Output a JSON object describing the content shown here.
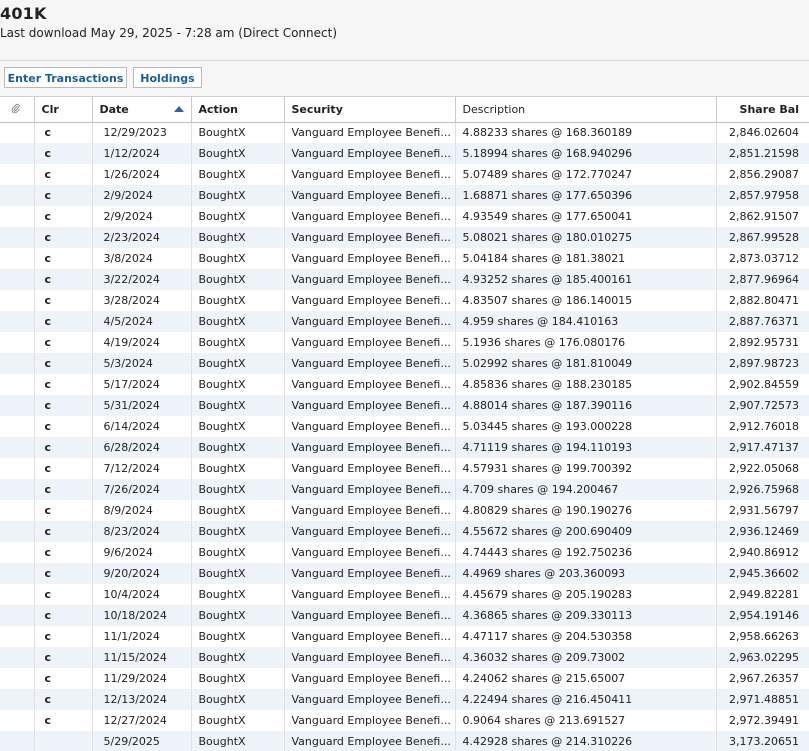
{
  "account": {
    "title": "401K",
    "last_download": "Last download May 29, 2025 - 7:28 am (Direct Connect)"
  },
  "tabs": {
    "enter_transactions": "Enter Transactions",
    "holdings": "Holdings"
  },
  "table": {
    "columns": {
      "attach_icon": "paperclip-icon",
      "clr": "Clr",
      "date": "Date",
      "action": "Action",
      "security": "Security",
      "description": "Description",
      "share_bal": "Share Bal"
    },
    "sort": {
      "column": "date",
      "direction": "ascending"
    },
    "rows": [
      {
        "clr": "c",
        "date": "12/29/2023",
        "action": "BoughtX",
        "security": "Vanguard Employee Benefi...",
        "description": "4.88233 shares @ 168.360189",
        "share_bal": "2,846.02604"
      },
      {
        "clr": "c",
        "date": "1/12/2024",
        "action": "BoughtX",
        "security": "Vanguard Employee Benefi...",
        "description": "5.18994 shares @ 168.940296",
        "share_bal": "2,851.21598"
      },
      {
        "clr": "c",
        "date": "1/26/2024",
        "action": "BoughtX",
        "security": "Vanguard Employee Benefi...",
        "description": "5.07489 shares @ 172.770247",
        "share_bal": "2,856.29087"
      },
      {
        "clr": "c",
        "date": "2/9/2024",
        "action": "BoughtX",
        "security": "Vanguard Employee Benefi...",
        "description": "1.68871 shares @ 177.650396",
        "share_bal": "2,857.97958"
      },
      {
        "clr": "c",
        "date": "2/9/2024",
        "action": "BoughtX",
        "security": "Vanguard Employee Benefi...",
        "description": "4.93549 shares @ 177.650041",
        "share_bal": "2,862.91507"
      },
      {
        "clr": "c",
        "date": "2/23/2024",
        "action": "BoughtX",
        "security": "Vanguard Employee Benefi...",
        "description": "5.08021 shares @ 180.010275",
        "share_bal": "2,867.99528"
      },
      {
        "clr": "c",
        "date": "3/8/2024",
        "action": "BoughtX",
        "security": "Vanguard Employee Benefi...",
        "description": "5.04184 shares @ 181.38021",
        "share_bal": "2,873.03712"
      },
      {
        "clr": "c",
        "date": "3/22/2024",
        "action": "BoughtX",
        "security": "Vanguard Employee Benefi...",
        "description": "4.93252 shares @ 185.400161",
        "share_bal": "2,877.96964"
      },
      {
        "clr": "c",
        "date": "3/28/2024",
        "action": "BoughtX",
        "security": "Vanguard Employee Benefi...",
        "description": "4.83507 shares @ 186.140015",
        "share_bal": "2,882.80471"
      },
      {
        "clr": "c",
        "date": "4/5/2024",
        "action": "BoughtX",
        "security": "Vanguard Employee Benefi...",
        "description": "4.959 shares @ 184.410163",
        "share_bal": "2,887.76371"
      },
      {
        "clr": "c",
        "date": "4/19/2024",
        "action": "BoughtX",
        "security": "Vanguard Employee Benefi...",
        "description": "5.1936 shares @ 176.080176",
        "share_bal": "2,892.95731"
      },
      {
        "clr": "c",
        "date": "5/3/2024",
        "action": "BoughtX",
        "security": "Vanguard Employee Benefi...",
        "description": "5.02992 shares @ 181.810049",
        "share_bal": "2,897.98723"
      },
      {
        "clr": "c",
        "date": "5/17/2024",
        "action": "BoughtX",
        "security": "Vanguard Employee Benefi...",
        "description": "4.85836 shares @ 188.230185",
        "share_bal": "2,902.84559"
      },
      {
        "clr": "c",
        "date": "5/31/2024",
        "action": "BoughtX",
        "security": "Vanguard Employee Benefi...",
        "description": "4.88014 shares @ 187.390116",
        "share_bal": "2,907.72573"
      },
      {
        "clr": "c",
        "date": "6/14/2024",
        "action": "BoughtX",
        "security": "Vanguard Employee Benefi...",
        "description": "5.03445 shares @ 193.000228",
        "share_bal": "2,912.76018"
      },
      {
        "clr": "c",
        "date": "6/28/2024",
        "action": "BoughtX",
        "security": "Vanguard Employee Benefi...",
        "description": "4.71119 shares @ 194.110193",
        "share_bal": "2,917.47137"
      },
      {
        "clr": "c",
        "date": "7/12/2024",
        "action": "BoughtX",
        "security": "Vanguard Employee Benefi...",
        "description": "4.57931 shares @ 199.700392",
        "share_bal": "2,922.05068"
      },
      {
        "clr": "c",
        "date": "7/26/2024",
        "action": "BoughtX",
        "security": "Vanguard Employee Benefi...",
        "description": "4.709 shares @ 194.200467",
        "share_bal": "2,926.75968"
      },
      {
        "clr": "c",
        "date": "8/9/2024",
        "action": "BoughtX",
        "security": "Vanguard Employee Benefi...",
        "description": "4.80829 shares @ 190.190276",
        "share_bal": "2,931.56797"
      },
      {
        "clr": "c",
        "date": "8/23/2024",
        "action": "BoughtX",
        "security": "Vanguard Employee Benefi...",
        "description": "4.55672 shares @ 200.690409",
        "share_bal": "2,936.12469"
      },
      {
        "clr": "c",
        "date": "9/6/2024",
        "action": "BoughtX",
        "security": "Vanguard Employee Benefi...",
        "description": "4.74443 shares @ 192.750236",
        "share_bal": "2,940.86912"
      },
      {
        "clr": "c",
        "date": "9/20/2024",
        "action": "BoughtX",
        "security": "Vanguard Employee Benefi...",
        "description": "4.4969 shares @ 203.360093",
        "share_bal": "2,945.36602"
      },
      {
        "clr": "c",
        "date": "10/4/2024",
        "action": "BoughtX",
        "security": "Vanguard Employee Benefi...",
        "description": "4.45679 shares @ 205.190283",
        "share_bal": "2,949.82281"
      },
      {
        "clr": "c",
        "date": "10/18/2024",
        "action": "BoughtX",
        "security": "Vanguard Employee Benefi...",
        "description": "4.36865 shares @ 209.330113",
        "share_bal": "2,954.19146"
      },
      {
        "clr": "c",
        "date": "11/1/2024",
        "action": "BoughtX",
        "security": "Vanguard Employee Benefi...",
        "description": "4.47117 shares @ 204.530358",
        "share_bal": "2,958.66263"
      },
      {
        "clr": "c",
        "date": "11/15/2024",
        "action": "BoughtX",
        "security": "Vanguard Employee Benefi...",
        "description": "4.36032 shares @ 209.73002",
        "share_bal": "2,963.02295"
      },
      {
        "clr": "c",
        "date": "11/29/2024",
        "action": "BoughtX",
        "security": "Vanguard Employee Benefi...",
        "description": "4.24062 shares @ 215.65007",
        "share_bal": "2,967.26357"
      },
      {
        "clr": "c",
        "date": "12/13/2024",
        "action": "BoughtX",
        "security": "Vanguard Employee Benefi...",
        "description": "4.22494 shares @ 216.450411",
        "share_bal": "2,971.48851"
      },
      {
        "clr": "c",
        "date": "12/27/2024",
        "action": "BoughtX",
        "security": "Vanguard Employee Benefi...",
        "description": "0.9064 shares @ 213.691527",
        "share_bal": "2,972.39491"
      },
      {
        "clr": "",
        "date": "5/29/2025",
        "action": "BoughtX",
        "security": "Vanguard Employee Benefi...",
        "description": "4.42928 shares @ 214.310226",
        "share_bal": "3,173.20651"
      }
    ]
  }
}
